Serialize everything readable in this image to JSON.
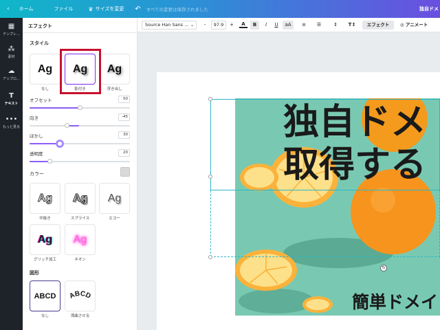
{
  "topbar": {
    "back_icon": "chevron-left-icon",
    "home": "ホーム",
    "file": "ファイル",
    "resize": "サイズを変更",
    "resize_icon": "crown-icon",
    "undo_icon": "undo-icon",
    "save_status": "すべての変更は保存されました",
    "design_title": "独自ドメ"
  },
  "rail": {
    "items": [
      {
        "label": "テンプレ…",
        "icon": "template-icon"
      },
      {
        "label": "素材",
        "icon": "elements-icon"
      },
      {
        "label": "アップロ…",
        "icon": "upload-icon"
      },
      {
        "label": "テキスト",
        "icon": "text-icon"
      },
      {
        "label": "もっと見る",
        "icon": "more-icon"
      }
    ]
  },
  "panel": {
    "title": "エフェクト",
    "style_section": "スタイル",
    "styles": [
      {
        "preview": "Ag",
        "label": "なし"
      },
      {
        "preview": "Ag",
        "label": "影付き"
      },
      {
        "preview": "Ag",
        "label": "浮き出し"
      }
    ],
    "sliders": [
      {
        "label": "オフセット",
        "value": "50",
        "percent": 50
      },
      {
        "label": "向き",
        "value": "-45",
        "percent": 37
      },
      {
        "label": "ぼかし",
        "value": "30",
        "percent": 30
      },
      {
        "label": "透明度",
        "value": "20",
        "percent": 20
      }
    ],
    "color_label": "カラー",
    "color_value": "#d9d9d9",
    "effects": [
      {
        "preview": "Ag",
        "label": "中抜き"
      },
      {
        "preview": "Ag",
        "label": "スプライス"
      },
      {
        "preview": "Ag",
        "label": "エコー"
      },
      {
        "preview": "Ag",
        "label": "グリッチ加工"
      },
      {
        "preview": "Ag",
        "label": "ネオン"
      }
    ],
    "shape_section": "図形",
    "shapes": [
      {
        "preview": "ABCD",
        "label": "なし"
      },
      {
        "preview": "ABCD",
        "label": "湾曲させる"
      }
    ]
  },
  "toolbar": {
    "font": "Source Han Sans ...",
    "font_size": "97.9",
    "minus": "-",
    "plus": "+",
    "bold": "B",
    "italic": "I",
    "underline": "U",
    "case": "aA",
    "text_color_icon": "text-color-icon",
    "align_icon": "align-left-icon",
    "list_icon": "list-icon",
    "spacing_icon": "spacing-icon",
    "vertical_text_icon": "vertical-text-icon",
    "effect": "エフェクト",
    "animate": "アニメート",
    "animate_icon": "animate-icon"
  },
  "canvas": {
    "title_line1": "独自ドメ",
    "title_line2": "取得する",
    "subtitle": "簡単ドメイ"
  },
  "colors": {
    "accent": "#7d2ae8",
    "highlight": "#c8102e",
    "selection": "#2bb6c9",
    "photo_bg": "#79c9b2",
    "orange": "#f7931e"
  }
}
